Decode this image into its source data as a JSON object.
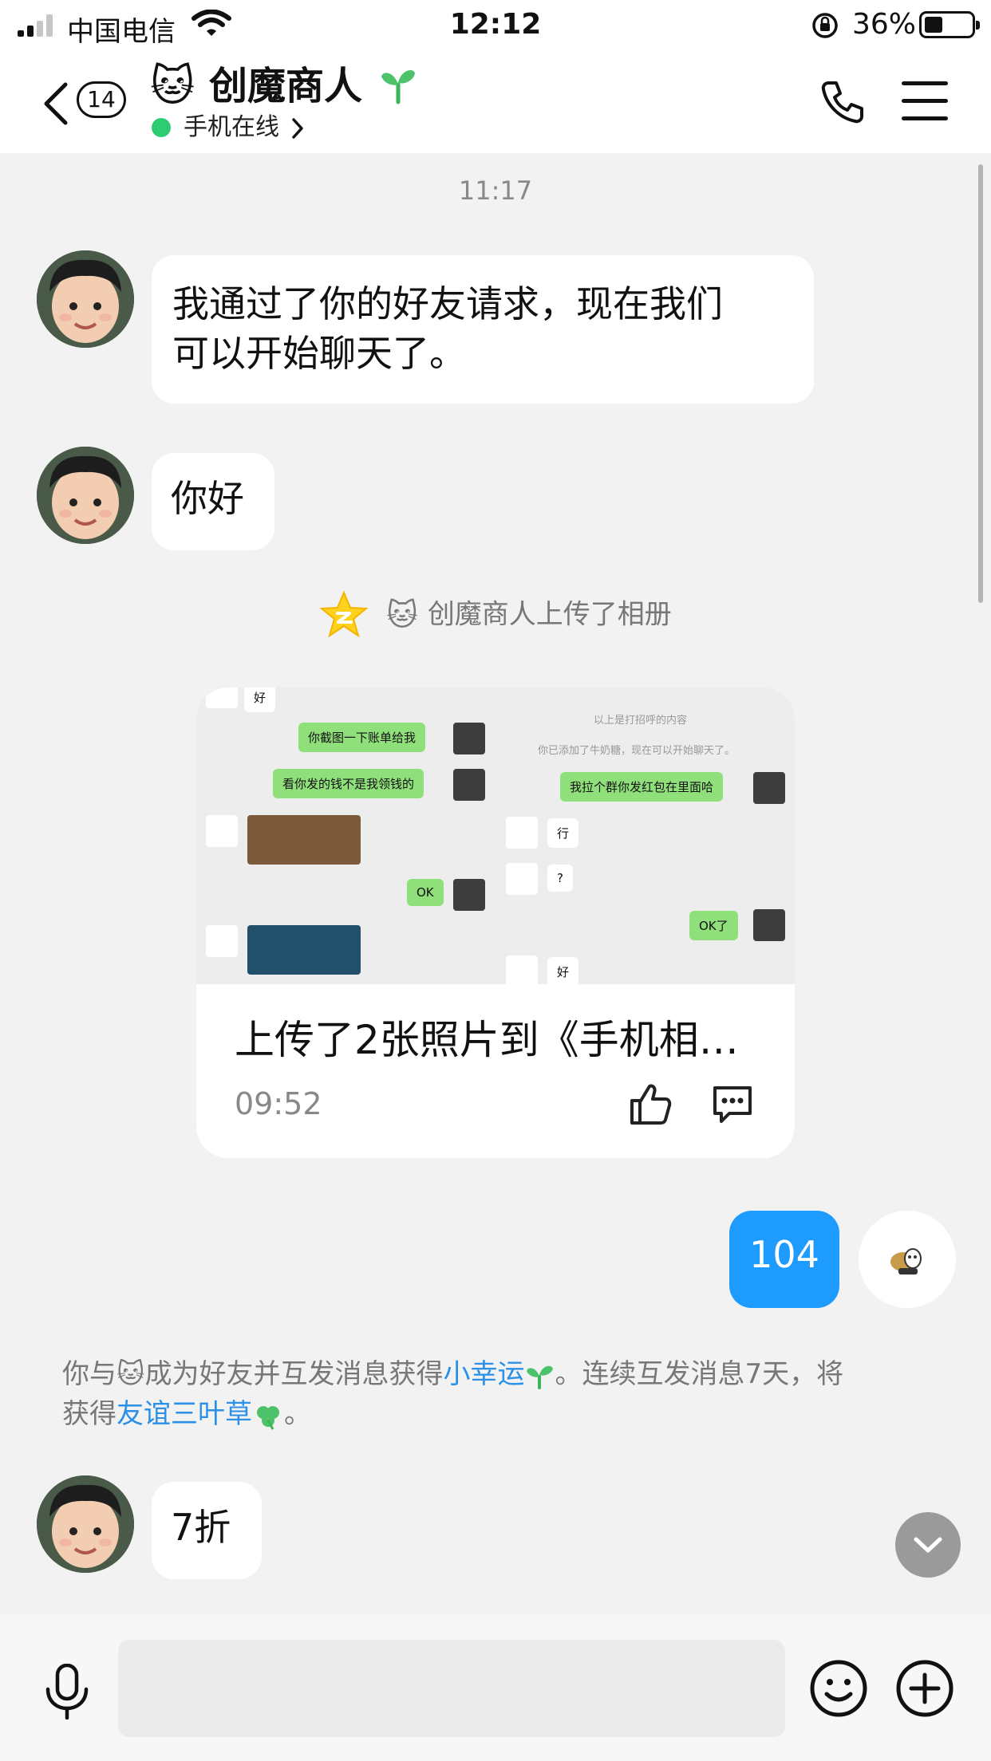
{
  "status_bar": {
    "carrier": "中国电信",
    "time": "12:12",
    "battery": "36%",
    "battery_level": 0.36
  },
  "header": {
    "unread_count": "14",
    "cat_emoji": "🐱",
    "contact_name": "创魔商人",
    "presence": "手机在线",
    "icons": [
      "back-icon",
      "sprout-icon",
      "chevron-right-icon",
      "phone-icon",
      "menu-icon"
    ]
  },
  "chat": {
    "timestamp": "11:17",
    "messages": [
      {
        "from": "contact",
        "text_line1": "我通过了你的好友请求，现在我们",
        "text_line2": "可以开始聊天了。"
      },
      {
        "from": "contact",
        "text": "你好"
      }
    ],
    "system_upload": {
      "cat_emoji": "🐱",
      "text": "创魔商人上传了相册"
    },
    "album_card": {
      "title": "上传了2张照片到《手机相…",
      "time": "09:52",
      "thumb_left": {
        "top_bubble": "好",
        "bubble1": "你截图一下账单给我",
        "bubble2": "看你发的钱不是我领钱的",
        "bubble3": "OK"
      },
      "thumb_right": {
        "note1": "以上是打招呼的内容",
        "note2": "你已添加了牛奶糖，现在可以开始聊天了。",
        "bubble1": "我拉个群你发红包在里面哈",
        "bubble2": "行",
        "bubble3": "?",
        "bubble4": "OK了",
        "bubble5": "好"
      }
    },
    "sent_message": {
      "from": "me",
      "text": "104"
    },
    "friendship_notice": {
      "part1": "你与",
      "cat_emoji": "🐱",
      "part2": "成为好友并互发消息获得",
      "link1": "小幸运",
      "part3": "。连续互发消息7天，将",
      "part4": "获得",
      "link2": "友谊三叶草",
      "part5": "。"
    },
    "last_message": {
      "from": "contact",
      "text": "7折"
    }
  },
  "input_bar": {
    "placeholder": "",
    "icons": [
      "microphone-icon",
      "emoji-icon",
      "plus-icon"
    ]
  },
  "colors": {
    "sent_bubble": "#1e9bff",
    "link": "#2b90e6",
    "online": "#2ecc71",
    "background": "#f2f2f2"
  }
}
